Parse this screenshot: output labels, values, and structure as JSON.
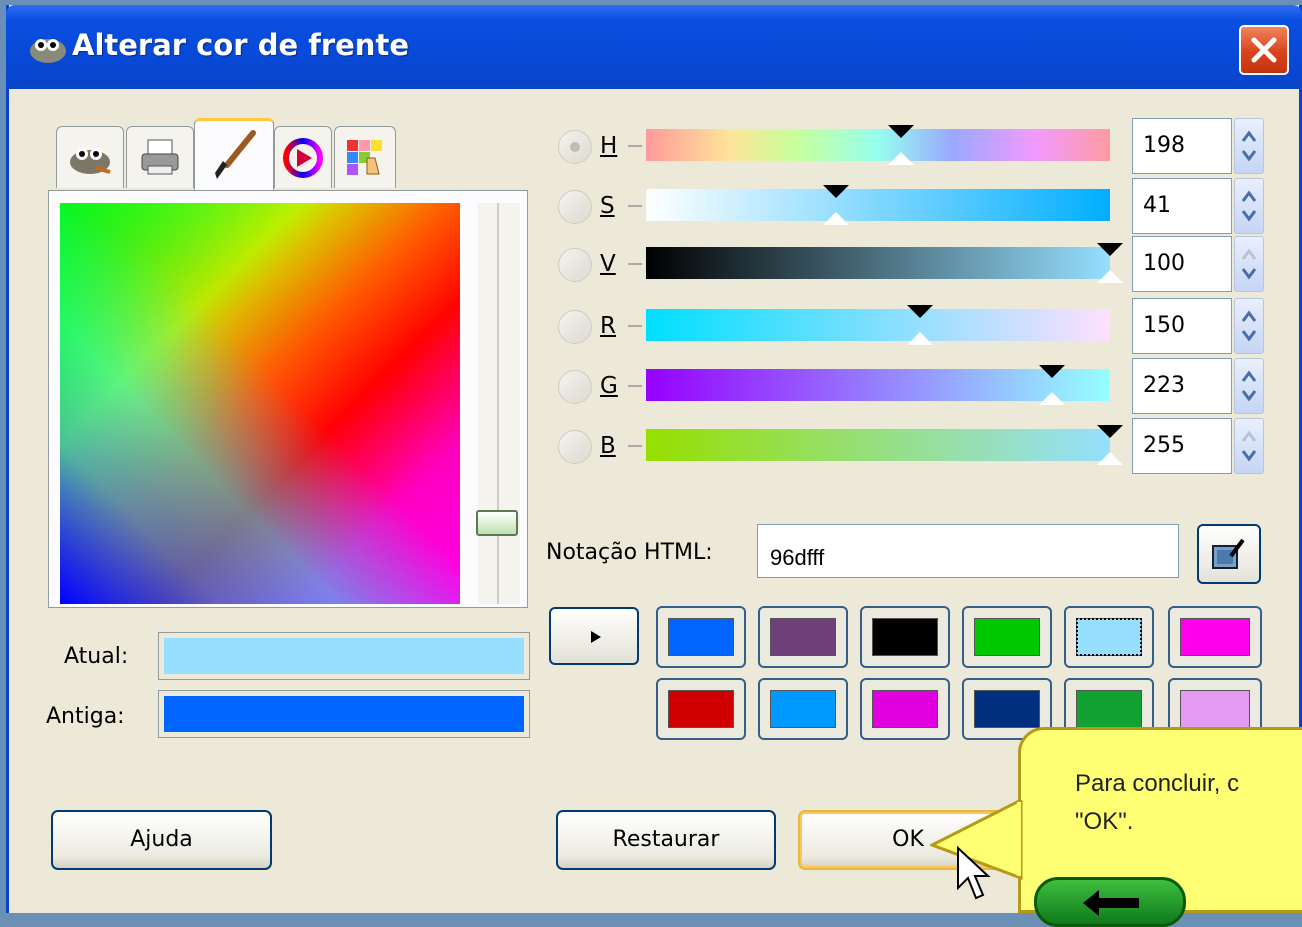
{
  "window": {
    "title": "Alterar cor de frente"
  },
  "tabs": [
    {
      "icon": "gimp-icon"
    },
    {
      "icon": "printer-icon"
    },
    {
      "icon": "paintbrush-icon"
    },
    {
      "icon": "color-wheel-icon"
    },
    {
      "icon": "palette-icon"
    }
  ],
  "current_label": "Atual:",
  "old_label": "Antiga:",
  "current_color": "#96dfff",
  "old_color": "#0066ff",
  "channels": [
    {
      "key": "h",
      "label": "H",
      "value": "198",
      "fraction": 0.55
    },
    {
      "key": "s",
      "label": "S",
      "value": "41",
      "fraction": 0.41
    },
    {
      "key": "v",
      "label": "V",
      "value": "100",
      "fraction": 1.0
    },
    {
      "key": "r",
      "label": "R",
      "value": "150",
      "fraction": 0.59
    },
    {
      "key": "g",
      "label": "G",
      "value": "223",
      "fraction": 0.875
    },
    {
      "key": "b",
      "label": "B",
      "value": "255",
      "fraction": 1.0
    }
  ],
  "html_notation": {
    "label": "Notação HTML:",
    "value": "96dfff"
  },
  "history_colors": [
    [
      "#0066ff",
      "#6f3f7a",
      "#000000",
      "#00c800",
      "#96dfff",
      "#ff00ee"
    ],
    [
      "#d00000",
      "#0099ff",
      "#e000e0",
      "#00307d",
      "#12a232",
      "#e39af2"
    ]
  ],
  "buttons": {
    "help": "Ajuda",
    "reset": "Restaurar",
    "ok": "OK"
  },
  "tooltip": {
    "text": "Para concluir, c\n\"OK\"."
  }
}
